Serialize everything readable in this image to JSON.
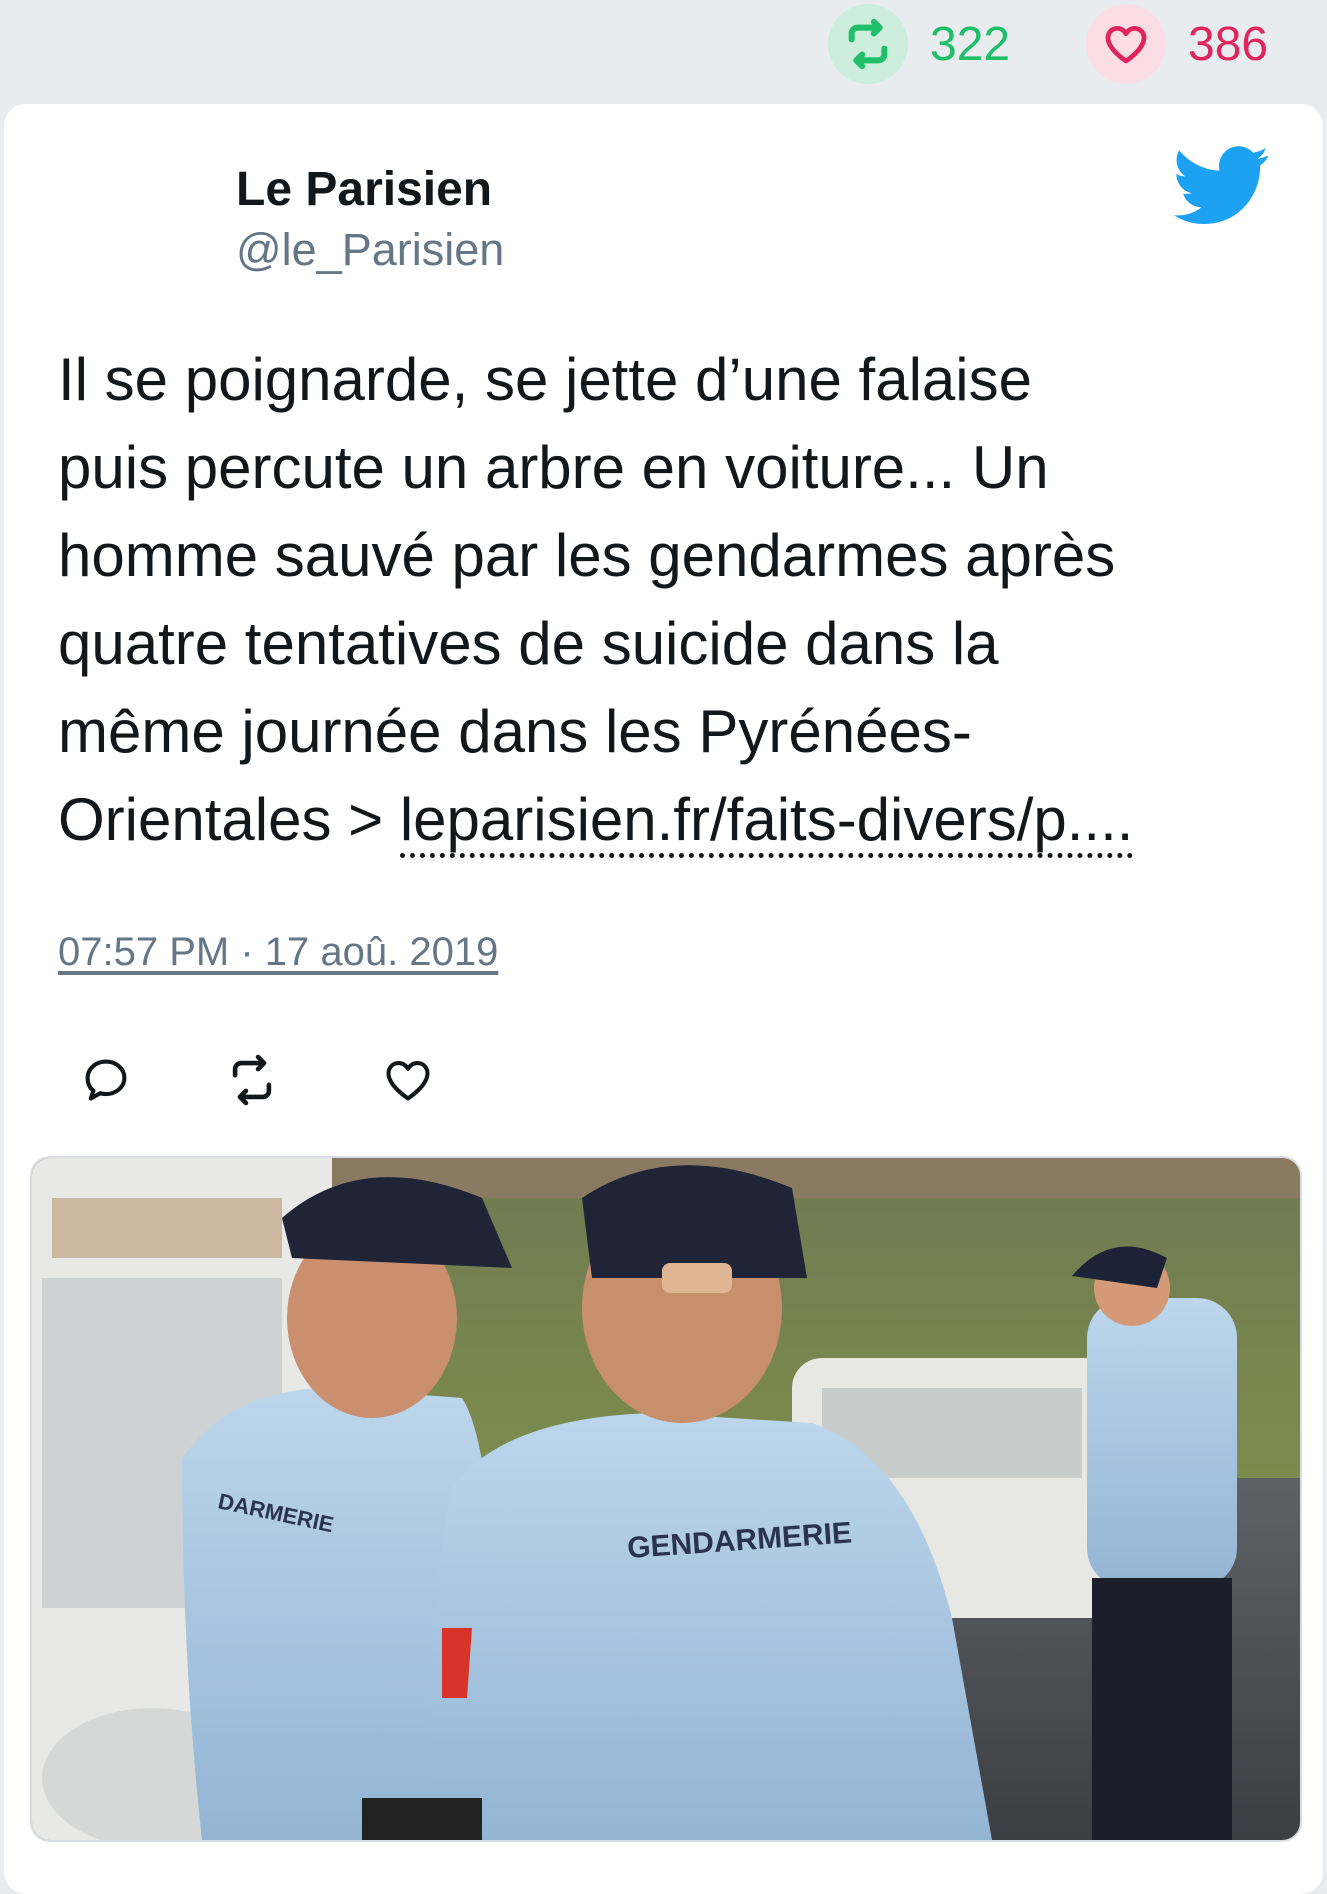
{
  "stats": {
    "retweets": "322",
    "likes": "386",
    "retweet_icon": "retweet-icon",
    "like_icon": "heart-icon"
  },
  "tweet": {
    "author_name": "Le Parisien",
    "author_handle": "@le_Parisien",
    "text_lines": [
      "Il se poignarde, se jette d’une falaise",
      "puis percute un arbre en voiture... Un",
      "homme sauvé par les gendarmes après",
      "quatre tentatives de suicide dans la",
      "même journée dans les Pyrénées-",
      "Orientales > "
    ],
    "link": "leparisien.fr/faits-divers/p....",
    "timestamp": "07:57 PM · 17 aoû. 2019",
    "platform_icon": "twitter-bird-icon"
  },
  "actions": [
    {
      "name": "reply",
      "icon": "reply-icon"
    },
    {
      "name": "retweet",
      "icon": "retweet-icon"
    },
    {
      "name": "like",
      "icon": "heart-icon"
    }
  ],
  "media": {
    "shirt_lettering_main": "GENDARMERIE",
    "shirt_lettering_side": "DARMERIE"
  },
  "colors": {
    "background": "#e9ecef",
    "retweet_green": "#1fbf6a",
    "like_pink": "#e0245e",
    "twitter_blue": "#1da1f2",
    "muted_text": "#657786"
  }
}
